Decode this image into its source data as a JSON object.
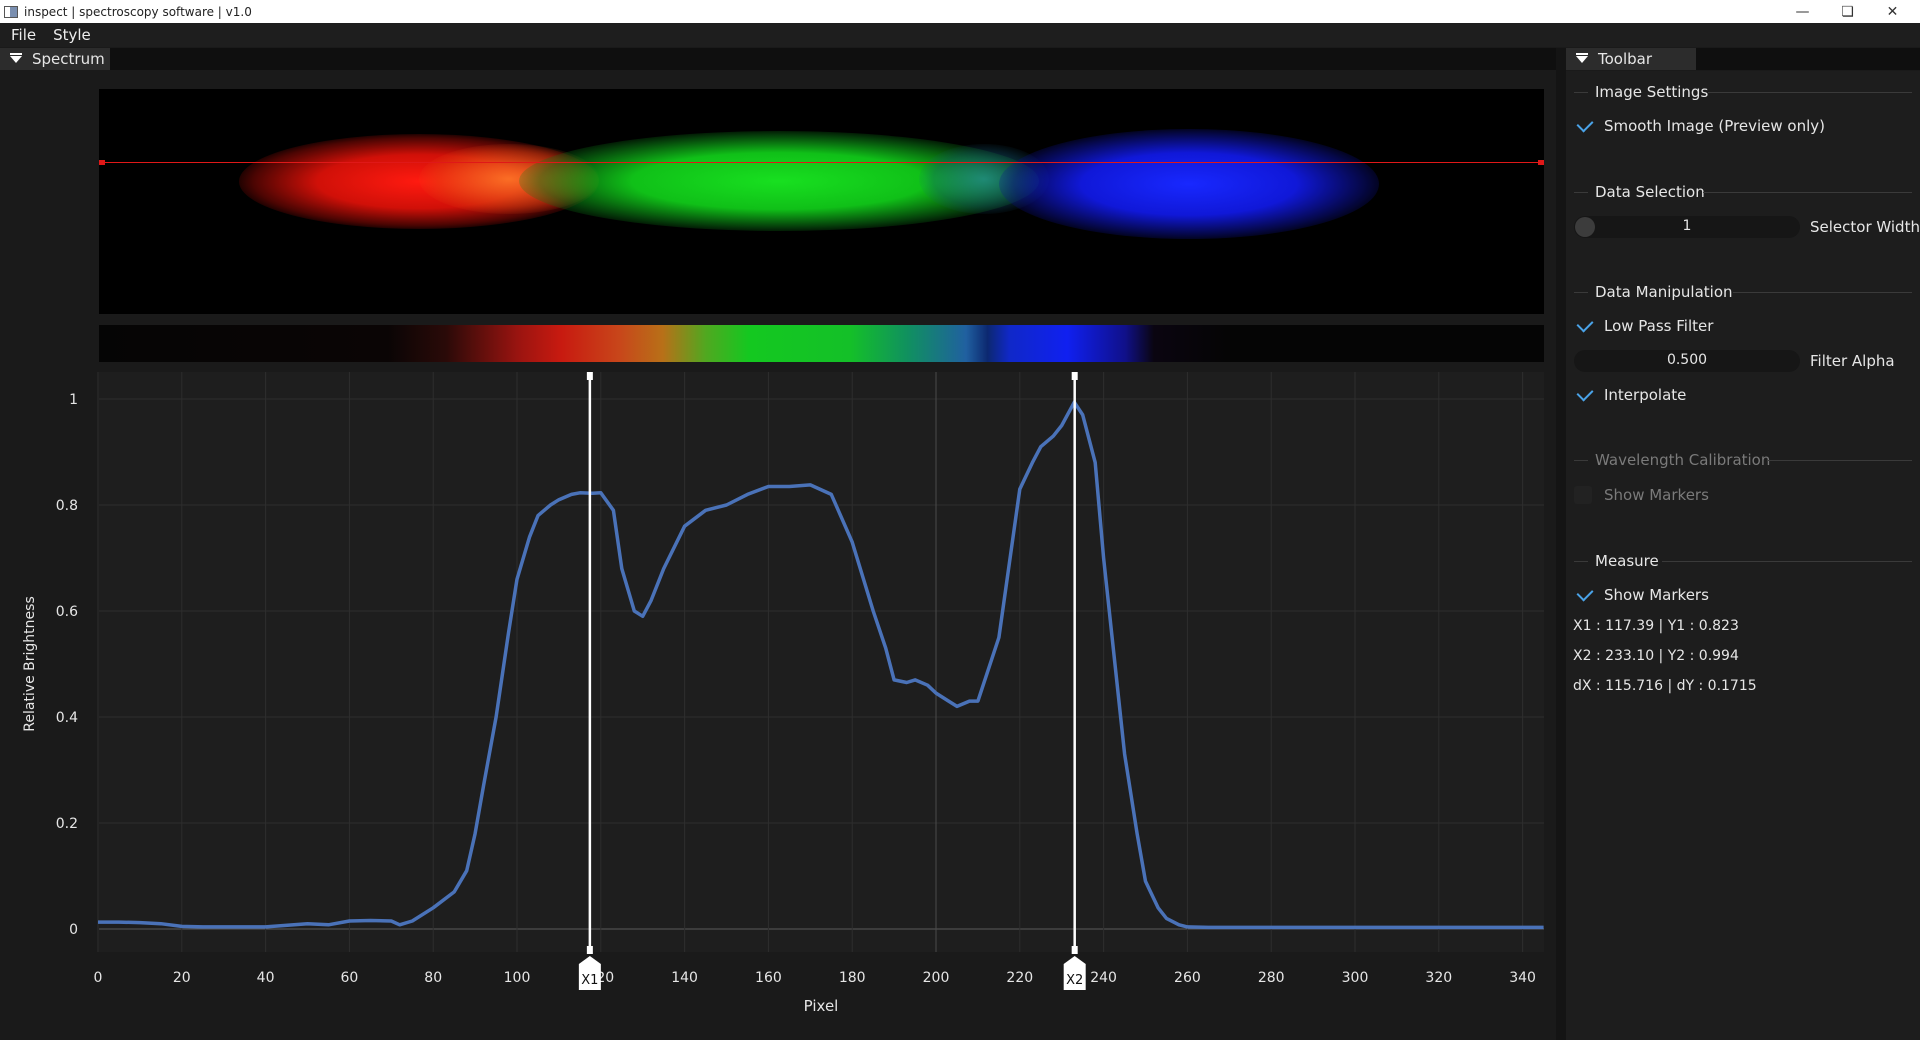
{
  "window": {
    "title": "inspect | spectroscopy software | v1.0",
    "minimize_icon": "minimize-icon",
    "maximize_icon": "restore-icon",
    "close_icon": "close-icon"
  },
  "menu": {
    "file": "File",
    "style": "Style"
  },
  "spectrum_panel": {
    "title": "Spectrum"
  },
  "toolbar_panel": {
    "title": "Toolbar",
    "image_settings": {
      "heading": "Image Settings",
      "smooth_image": "Smooth Image (Preview only)",
      "smooth_checked": true
    },
    "data_selection": {
      "heading": "Data Selection",
      "selector_value": "1",
      "selector_label": "Selector Width"
    },
    "data_manipulation": {
      "heading": "Data Manipulation",
      "low_pass": "Low Pass Filter",
      "low_pass_checked": true,
      "alpha_value": "0.500",
      "alpha_label": "Filter Alpha",
      "interpolate": "Interpolate",
      "interpolate_checked": true
    },
    "wavelength_calibration": {
      "heading": "Wavelength Calibration",
      "show_markers": "Show Markers",
      "show_markers_checked": false
    },
    "measure": {
      "heading": "Measure",
      "show_markers": "Show Markers",
      "show_markers_checked": true,
      "line1": "X1 : 117.39 | Y1 : 0.823",
      "line2": "X2 : 233.10 | Y2 : 0.994",
      "line3": "dX : 115.716 | dY : 0.1715"
    }
  },
  "chart_data": {
    "type": "line",
    "xlabel": "Pixel",
    "ylabel": "Relative Brightness",
    "xlim": [
      0,
      345
    ],
    "ylim": [
      0,
      1
    ],
    "xticks": [
      "0",
      "20",
      "40",
      "60",
      "80",
      "100",
      "120",
      "140",
      "160",
      "180",
      "200",
      "220",
      "240",
      "260",
      "280",
      "300",
      "320",
      "340"
    ],
    "yticks": [
      "0",
      "0.2",
      "0.4",
      "0.6",
      "0.8",
      "1"
    ],
    "grid": true,
    "line_color": "#4a72b8",
    "x": [
      0,
      5,
      10,
      15,
      20,
      25,
      30,
      40,
      50,
      55,
      60,
      65,
      70,
      72,
      75,
      80,
      85,
      88,
      90,
      92,
      95,
      98,
      100,
      103,
      105,
      108,
      110,
      113,
      115,
      118,
      120,
      123,
      125,
      128,
      130,
      132,
      135,
      140,
      145,
      150,
      155,
      160,
      165,
      170,
      175,
      180,
      185,
      188,
      190,
      193,
      195,
      198,
      200,
      203,
      205,
      208,
      210,
      215,
      220,
      223,
      225,
      228,
      230,
      233,
      235,
      238,
      240,
      245,
      248,
      250,
      253,
      255,
      258,
      260,
      265,
      270,
      280,
      300,
      320,
      345
    ],
    "y": [
      0.013,
      0.013,
      0.012,
      0.01,
      0.005,
      0.004,
      0.004,
      0.004,
      0.01,
      0.008,
      0.015,
      0.016,
      0.015,
      0.008,
      0.015,
      0.04,
      0.07,
      0.11,
      0.18,
      0.27,
      0.4,
      0.56,
      0.66,
      0.74,
      0.78,
      0.8,
      0.81,
      0.82,
      0.823,
      0.822,
      0.823,
      0.79,
      0.68,
      0.6,
      0.59,
      0.62,
      0.68,
      0.76,
      0.79,
      0.8,
      0.82,
      0.835,
      0.835,
      0.838,
      0.82,
      0.73,
      0.6,
      0.53,
      0.47,
      0.465,
      0.47,
      0.46,
      0.445,
      0.43,
      0.42,
      0.43,
      0.43,
      0.55,
      0.83,
      0.88,
      0.91,
      0.93,
      0.95,
      0.994,
      0.97,
      0.88,
      0.7,
      0.33,
      0.18,
      0.09,
      0.04,
      0.02,
      0.008,
      0.004,
      0.003,
      0.003,
      0.003,
      0.003,
      0.003,
      0.003
    ],
    "markers": [
      {
        "label": "X1",
        "x": 117.39
      },
      {
        "label": "X2",
        "x": 233.1
      }
    ]
  }
}
